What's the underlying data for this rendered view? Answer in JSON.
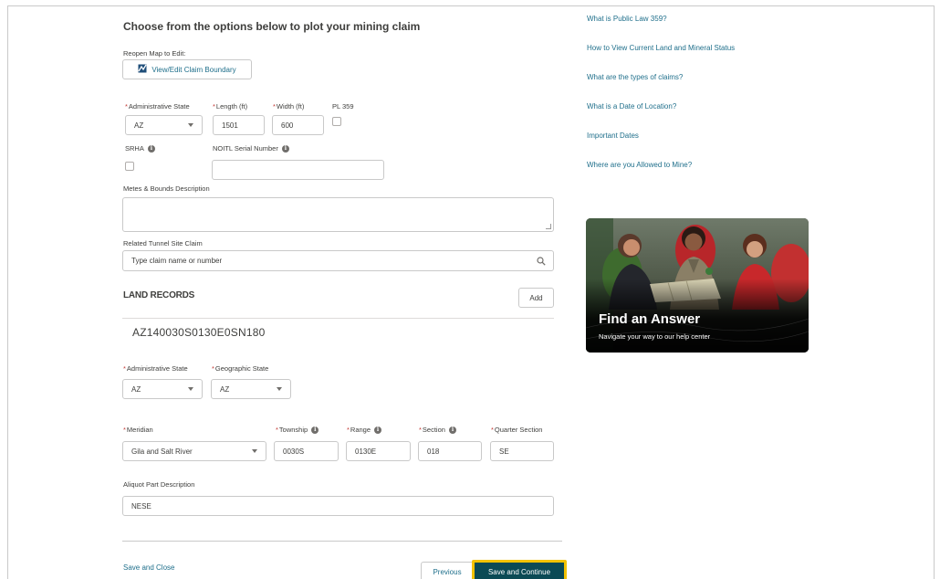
{
  "page": {
    "title": "Choose from the options below to plot your mining claim",
    "reopen_label": "Reopen Map to Edit:",
    "view_edit_button": "View/Edit Claim Boundary"
  },
  "claim": {
    "admin_state_label": "Administrative State",
    "admin_state_value": "AZ",
    "length_label": "Length (ft)",
    "length_value": "1501",
    "width_label": "Width (ft)",
    "width_value": "600",
    "pl359_label": "PL 359",
    "srha_label": "SRHA",
    "noitl_label": "NOITL Serial Number",
    "noitl_value": "",
    "metes_label": "Metes & Bounds Description",
    "tunnel_label": "Related Tunnel Site Claim",
    "tunnel_placeholder": "Type claim name or number"
  },
  "land_records": {
    "heading": "LAND RECORDS",
    "add_button": "Add",
    "serial": "AZ140030S0130E0SN180",
    "admin_state_label": "Administrative State",
    "admin_state_value": "AZ",
    "geo_state_label": "Geographic State",
    "geo_state_value": "AZ",
    "meridian_label": "Meridian",
    "meridian_value": "Gila and Salt River",
    "township_label": "Township",
    "township_value": "0030S",
    "range_label": "Range",
    "range_value": "0130E",
    "section_label": "Section",
    "section_value": "018",
    "quarter_label": "Quarter Section",
    "quarter_value": "SE",
    "aliquot_label": "Aliquot Part Description",
    "aliquot_value": "NESE"
  },
  "footer": {
    "save_close": "Save and Close",
    "previous": "Previous",
    "save_continue": "Save and Continue"
  },
  "sidebar": {
    "links": [
      "What is Public Law 359?",
      "How to View Current Land and Mineral Status",
      "What are the types of claims?",
      "What is a Date of Location?",
      "Important Dates",
      "Where are you Allowed to Mine?"
    ],
    "card_title": "Find an Answer",
    "card_subtitle": "Navigate your way to our help center"
  },
  "required_marker": "*",
  "info_glyph": "i",
  "colors": {
    "link": "#1f6f8b",
    "required": "#c23934",
    "primary_button": "#0b4a55",
    "focus_outline": "#f2c200"
  },
  "icons": [
    "map-icon",
    "info-icon",
    "search-icon",
    "chevron-down-icon",
    "resize-grip-icon"
  ]
}
